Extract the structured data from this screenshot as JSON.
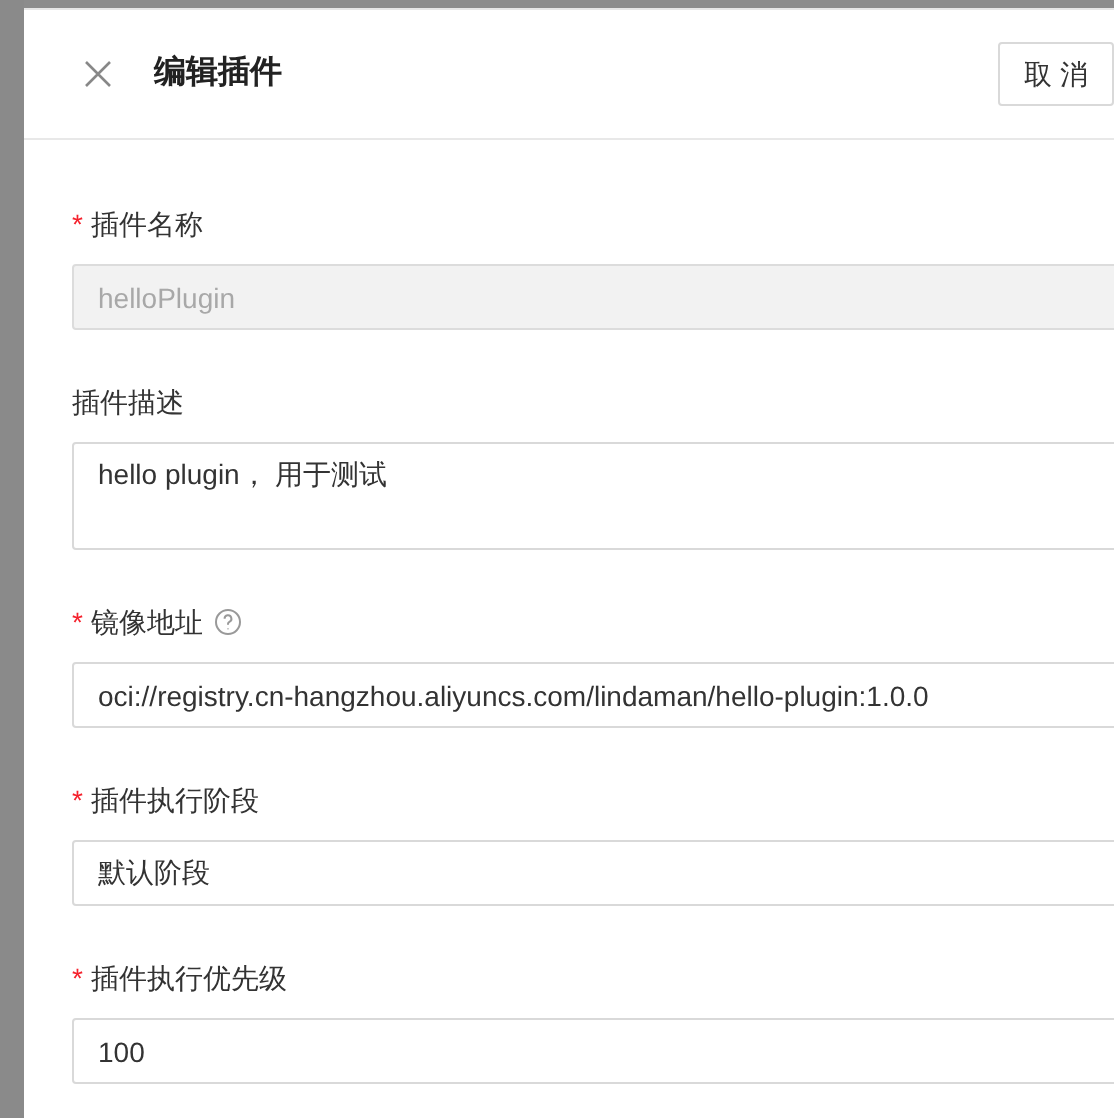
{
  "drawer": {
    "title": "编辑插件",
    "cancel_button": "取 消"
  },
  "fields": [
    {
      "kind": "input",
      "required_mark": "*",
      "label": "插件名称",
      "disabled": true,
      "value": "helloPlugin"
    },
    {
      "kind": "textarea",
      "label": "插件描述",
      "disabled": false,
      "value": "hello plugin， 用于测试"
    },
    {
      "kind": "input",
      "required_mark": "*",
      "label": "镜像地址",
      "help": true,
      "disabled": false,
      "value": "oci://registry.cn-hangzhou.aliyuncs.com/lindaman/hello-plugin:1.0.0"
    },
    {
      "kind": "input",
      "required_mark": "*",
      "label": "插件执行阶段",
      "disabled": false,
      "value": "默认阶段"
    },
    {
      "kind": "input",
      "required_mark": "*",
      "label": "插件执行优先级",
      "disabled": false,
      "value": "100"
    }
  ]
}
